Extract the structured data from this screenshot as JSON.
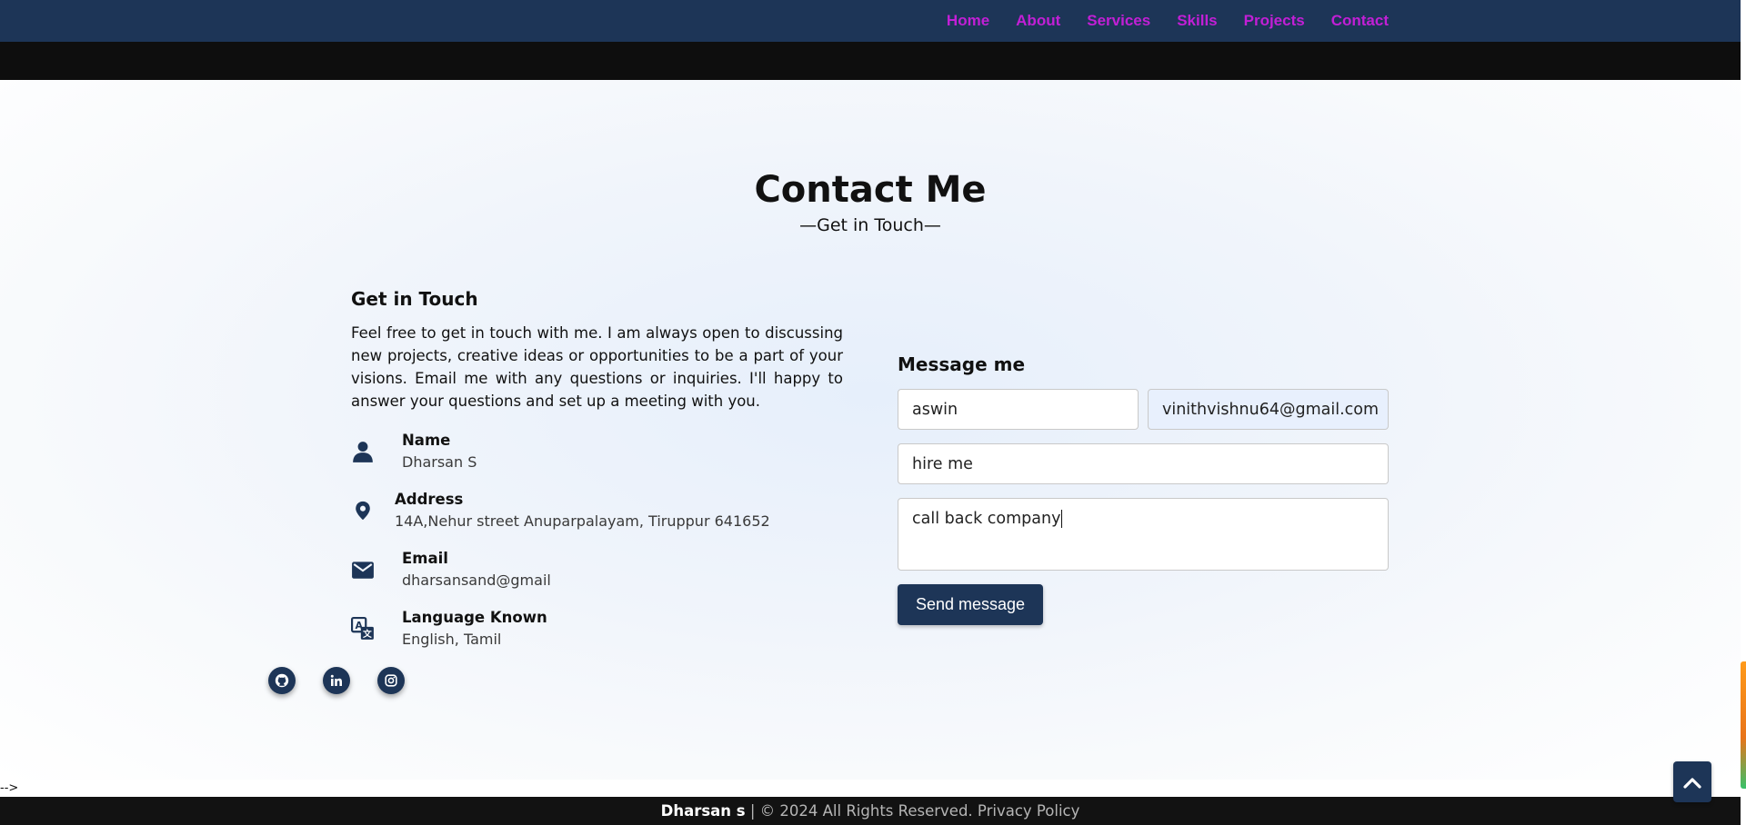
{
  "nav": {
    "items": [
      "Home",
      "About",
      "Services",
      "Skills",
      "Projects",
      "Contact"
    ],
    "link_color": "#c21fd6",
    "bg_color": "#1d3557"
  },
  "section": {
    "title": "Contact Me",
    "subtitle": "—Get in Touch—"
  },
  "left": {
    "title": "Get in Touch",
    "description": "Feel free to get in touch with me. I am always open to discussing new projects, creative ideas or opportunities to be a part of your visions. Email me with any questions or inquiries. I'll happy to answer your questions and set up a meeting with you.",
    "info": [
      {
        "icon": "user-icon",
        "label": "Name",
        "value": "Dharsan S"
      },
      {
        "icon": "map-pin-icon",
        "label": "Address",
        "value": "14A,Nehur street Anuparpalayam, Tiruppur 641652"
      },
      {
        "icon": "envelope-icon",
        "label": "Email",
        "value": "dharsansand@gmail"
      },
      {
        "icon": "language-icon",
        "label": "Language Known",
        "value": "English, Tamil"
      }
    ],
    "social": [
      "github-icon",
      "linkedin-icon",
      "instagram-icon"
    ]
  },
  "form": {
    "title": "Message me",
    "name_value": "aswin",
    "email_value": "vinithvishnu64@gmail.com",
    "subject_value": "hire me",
    "message_value": "call back company",
    "send_label": "Send message"
  },
  "stray_text": "-->",
  "footer": {
    "owner": "Dharsan s",
    "rights": "| © 2024 All Rights Reserved. Privacy Policy"
  },
  "back_to_top_icon": "chevron-up-icon",
  "accent_color": "#1d3557"
}
